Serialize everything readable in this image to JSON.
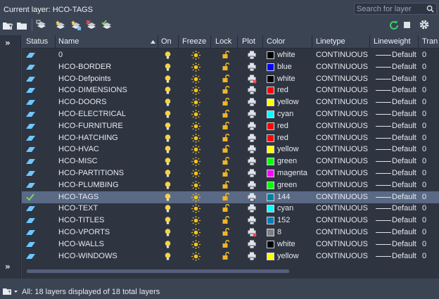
{
  "header": {
    "current_layer_label": "Current layer: HCO-TAGS",
    "search_placeholder": "Search for layer"
  },
  "toolbar": {
    "left_icons": [
      "new-property-filter-icon",
      "new-group-filter-icon",
      "layer-states-manager-icon",
      "new-layer-icon",
      "new-layer-vp-frozen-icon",
      "delete-layer-icon",
      "set-current-icon"
    ],
    "right_icons": [
      "refresh-icon",
      "square-icon",
      "settings-icon"
    ]
  },
  "sidebar": {
    "expand_top": "»",
    "expand_bottom": "»"
  },
  "columns": {
    "status": "Status",
    "name": "Name",
    "on": "On",
    "freeze": "Freeze",
    "lock": "Lock",
    "plot": "Plot",
    "color": "Color",
    "linetype": "Linetype",
    "lineweight": "Lineweight",
    "transparency": "Tran"
  },
  "colors": {
    "accent_selected_row": "#5a6a85",
    "status_icon": "#6ec6ff",
    "current_check": "#7ddc5c",
    "bulb": "#f5d24a",
    "sun": "#f5c518",
    "lock": "#f0b429"
  },
  "layers": [
    {
      "name": "0",
      "color_name": "white",
      "color_hex": "#000000",
      "linetype": "CONTINUOUS",
      "lineweight": "Default",
      "transparency": "0",
      "plot_off": false,
      "current": false
    },
    {
      "name": "HCO-BORDER",
      "color_name": "blue",
      "color_hex": "#0000ff",
      "linetype": "CONTINUOUS",
      "lineweight": "Default",
      "transparency": "0",
      "plot_off": false,
      "current": false
    },
    {
      "name": "HCO-Defpoints",
      "color_name": "white",
      "color_hex": "#000000",
      "linetype": "CONTINUOUS",
      "lineweight": "Default",
      "transparency": "0",
      "plot_off": true,
      "current": false
    },
    {
      "name": "HCO-DIMENSIONS",
      "color_name": "red",
      "color_hex": "#ff0000",
      "linetype": "CONTINUOUS",
      "lineweight": "Default",
      "transparency": "0",
      "plot_off": false,
      "current": false
    },
    {
      "name": "HCO-DOORS",
      "color_name": "yellow",
      "color_hex": "#ffff00",
      "linetype": "CONTINUOUS",
      "lineweight": "Default",
      "transparency": "0",
      "plot_off": false,
      "current": false
    },
    {
      "name": "HCO-ELECTRICAL",
      "color_name": "cyan",
      "color_hex": "#00ffff",
      "linetype": "CONTINUOUS",
      "lineweight": "Default",
      "transparency": "0",
      "plot_off": false,
      "current": false
    },
    {
      "name": "HCO-FURNITURE",
      "color_name": "red",
      "color_hex": "#ff0000",
      "linetype": "CONTINUOUS",
      "lineweight": "Default",
      "transparency": "0",
      "plot_off": false,
      "current": false
    },
    {
      "name": "HCO-HATCHING",
      "color_name": "red",
      "color_hex": "#ff0000",
      "linetype": "CONTINUOUS",
      "lineweight": "Default",
      "transparency": "0",
      "plot_off": false,
      "current": false
    },
    {
      "name": "HCO-HVAC",
      "color_name": "yellow",
      "color_hex": "#ffff00",
      "linetype": "CONTINUOUS",
      "lineweight": "Default",
      "transparency": "0",
      "plot_off": false,
      "current": false
    },
    {
      "name": "HCO-MISC",
      "color_name": "green",
      "color_hex": "#00ff00",
      "linetype": "CONTINUOUS",
      "lineweight": "Default",
      "transparency": "0",
      "plot_off": false,
      "current": false
    },
    {
      "name": "HCO-PARTITIONS",
      "color_name": "magenta",
      "color_hex": "#ff00ff",
      "linetype": "CONTINUOUS",
      "lineweight": "Default",
      "transparency": "0",
      "plot_off": false,
      "current": false
    },
    {
      "name": "HCO-PLUMBING",
      "color_name": "green",
      "color_hex": "#00ff00",
      "linetype": "CONTINUOUS",
      "lineweight": "Default",
      "transparency": "0",
      "plot_off": false,
      "current": false
    },
    {
      "name": "HCO-TAGS",
      "color_name": "144",
      "color_hex": "#007f9f",
      "linetype": "CONTINUOUS",
      "lineweight": "Default",
      "transparency": "0",
      "plot_off": false,
      "current": true
    },
    {
      "name": "HCO-TEXT",
      "color_name": "cyan",
      "color_hex": "#00ffff",
      "linetype": "CONTINUOUS",
      "lineweight": "Default",
      "transparency": "0",
      "plot_off": false,
      "current": false
    },
    {
      "name": "HCO-TITLES",
      "color_name": "152",
      "color_hex": "#007fbf",
      "linetype": "CONTINUOUS",
      "lineweight": "Default",
      "transparency": "0",
      "plot_off": false,
      "current": false
    },
    {
      "name": "HCO-VPORTS",
      "color_name": "8",
      "color_hex": "#808080",
      "linetype": "CONTINUOUS",
      "lineweight": "Default",
      "transparency": "0",
      "plot_off": true,
      "current": false
    },
    {
      "name": "HCO-WALLS",
      "color_name": "white",
      "color_hex": "#000000",
      "linetype": "CONTINUOUS",
      "lineweight": "Default",
      "transparency": "0",
      "plot_off": false,
      "current": false
    },
    {
      "name": "HCO-WINDOWS",
      "color_name": "yellow",
      "color_hex": "#ffff00",
      "linetype": "CONTINUOUS",
      "lineweight": "Default",
      "transparency": "0",
      "plot_off": false,
      "current": false
    }
  ],
  "footer": {
    "status_text": "All: 18 layers displayed of 18 total layers"
  }
}
